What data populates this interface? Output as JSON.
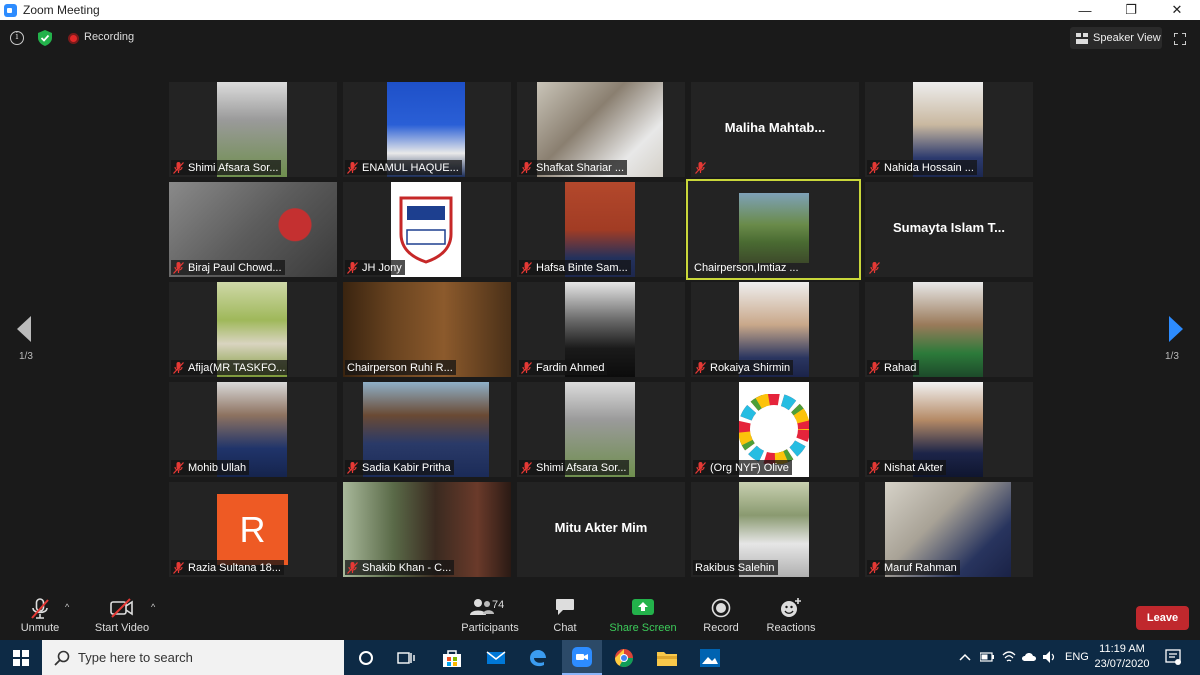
{
  "window": {
    "title": "Zoom Meeting",
    "minimize": "—",
    "maximize": "❐",
    "close": "✕"
  },
  "topbar": {
    "recording_label": "Recording",
    "speaker_view_label": "Speaker View"
  },
  "paging": {
    "left_page": "1/3",
    "right_page": "1/3"
  },
  "participants": [
    {
      "name": "Shimi Afsara Sor...",
      "muted": true,
      "video": true
    },
    {
      "name": "ENAMUL HAQUE...",
      "muted": true,
      "video": true
    },
    {
      "name": "Shafkat Shariar ...",
      "muted": true,
      "video": true
    },
    {
      "name": "",
      "display_name": "Maliha  Mahtab...",
      "muted": true,
      "video": false
    },
    {
      "name": "Nahida Hossain ...",
      "muted": true,
      "video": true
    },
    {
      "name": "Biraj Paul Chowd...",
      "muted": true,
      "video": true
    },
    {
      "name": "JH Jony",
      "muted": true,
      "video": true
    },
    {
      "name": "Hafsa Binte Sam...",
      "muted": true,
      "video": true
    },
    {
      "name": "Chairperson,Imtiaz ...",
      "muted": false,
      "video": true,
      "active": true
    },
    {
      "name": "",
      "display_name": "Sumayta Islam T...",
      "muted": true,
      "video": false
    },
    {
      "name": "Afija(MR TASKFO...",
      "muted": true,
      "video": true
    },
    {
      "name": "Chairperson Ruhi R...",
      "muted": false,
      "video": true
    },
    {
      "name": "Fardin Ahmed",
      "muted": true,
      "video": true
    },
    {
      "name": "Rokaiya Shirmin",
      "muted": true,
      "video": true
    },
    {
      "name": "Rahad",
      "muted": true,
      "video": true
    },
    {
      "name": "Mohib Ullah",
      "muted": true,
      "video": true
    },
    {
      "name": "Sadia Kabir Pritha",
      "muted": true,
      "video": true
    },
    {
      "name": "Shimi Afsara Sor...",
      "muted": true,
      "video": true
    },
    {
      "name": "(Org NYF) Olive",
      "muted": true,
      "video": true
    },
    {
      "name": "Nishat Akter",
      "muted": true,
      "video": true
    },
    {
      "name": "Razia Sultana 18...",
      "muted": true,
      "video": false,
      "avatar_letter": "R"
    },
    {
      "name": "Shakib Khan - C...",
      "muted": true,
      "video": true
    },
    {
      "name": "",
      "display_name": "Mitu Akter Mim",
      "muted": false,
      "video": false
    },
    {
      "name": "Rakibus Salehin",
      "muted": false,
      "video": true
    },
    {
      "name": "Maruf Rahman",
      "muted": true,
      "video": true
    }
  ],
  "toolbar": {
    "unmute_label": "Unmute",
    "start_video_label": "Start Video",
    "participants_label": "Participants",
    "participants_count": "74",
    "chat_label": "Chat",
    "share_screen_label": "Share Screen",
    "record_label": "Record",
    "reactions_label": "Reactions",
    "leave_label": "Leave"
  },
  "taskbar": {
    "search_placeholder": "Type here to search",
    "language": "ENG",
    "time": "11:19 AM",
    "date": "23/07/2020"
  },
  "colors": {
    "background": "#1a1a1a",
    "active_speaker_border": "#c9d73a",
    "share_green": "#3ccb5a",
    "leave_red": "#c0282d",
    "recording_red": "#e02828",
    "page_arrow_blue": "#2d8cff"
  }
}
